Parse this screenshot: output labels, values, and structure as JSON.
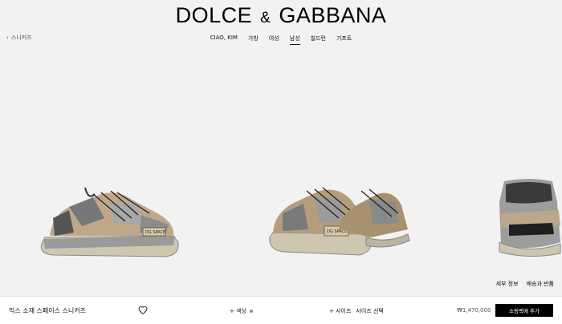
{
  "brand": {
    "part1": "DOLCE",
    "amp": "&",
    "part2": "GABBANA"
  },
  "breadcrumb": {
    "label": "스니커즈"
  },
  "nav": {
    "items": [
      {
        "label": "CIAO, KIM"
      },
      {
        "label": "가방"
      },
      {
        "label": "여성"
      },
      {
        "label": "남성"
      },
      {
        "label": "칠드런"
      },
      {
        "label": "기프트"
      }
    ],
    "active": "남성"
  },
  "gallery": {
    "links": {
      "details": "세부 정보",
      "shipping": "배송과 반품"
    },
    "shoe_badge_text": "DG SPACE"
  },
  "product": {
    "name": "믹스 소재 스페이스 스니커즈",
    "color_label": "+ 색상",
    "size_label": "+ 사이즈",
    "size_select": "사이즈 선택",
    "price": "₩1,470,000",
    "add_to_bag": "쇼핑백에 추가"
  }
}
